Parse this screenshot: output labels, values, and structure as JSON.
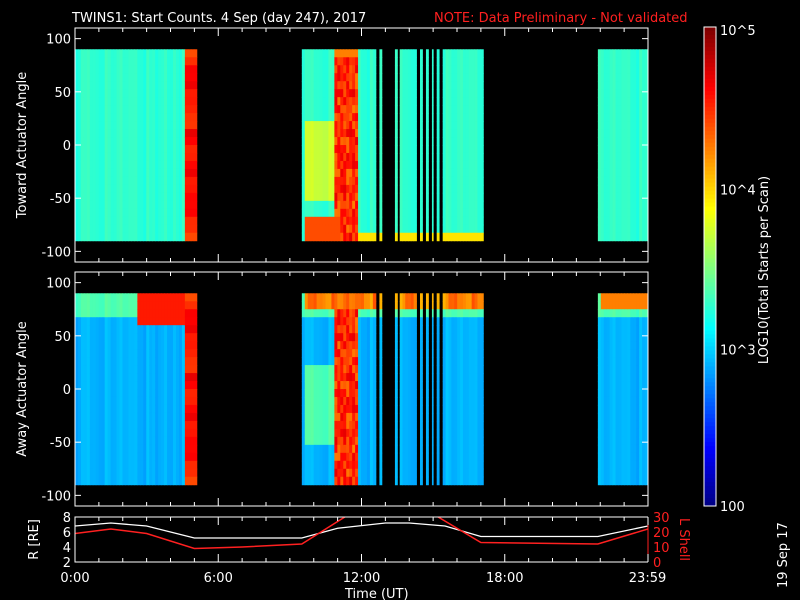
{
  "chart_data": {
    "type": "heatmap",
    "title": "TWINS1: Start Counts.  4 Sep (day 247), 2017",
    "note": "NOTE: Data Preliminary - Not validated",
    "date_stamp": "19 Sep 17",
    "xlabel": "Time (UT)",
    "xticks": [
      {
        "h": 0,
        "label": "0:00"
      },
      {
        "h": 6,
        "label": "6:00"
      },
      {
        "h": 12,
        "label": "12:00"
      },
      {
        "h": 18,
        "label": "18:00"
      },
      {
        "h": 23.98,
        "label": "23:59"
      }
    ],
    "xlim": [
      0,
      24
    ],
    "panels": [
      {
        "ylabel": "Toward Actuator Angle",
        "ylim": [
          -110,
          110
        ],
        "yticks": [
          "100",
          "50",
          "0",
          "-50",
          "-100"
        ],
        "ytick_values": [
          100,
          50,
          0,
          -50,
          -100
        ]
      },
      {
        "ylabel": "Away Actuator Angle",
        "ylim": [
          -110,
          110
        ],
        "yticks": [
          "100",
          "50",
          "0",
          "-50",
          "-100"
        ],
        "ytick_values": [
          100,
          50,
          0,
          -50,
          -100
        ]
      }
    ],
    "angle_range": [
      -90,
      90
    ],
    "data_intervals_hours": [
      [
        0,
        5.1
      ],
      [
        9.5,
        12.6
      ],
      [
        12.75,
        12.85
      ],
      [
        13.4,
        13.5
      ],
      [
        13.6,
        14.3
      ],
      [
        14.45,
        14.55
      ],
      [
        14.7,
        14.8
      ],
      [
        14.95,
        15.0
      ],
      [
        15.15,
        15.25
      ],
      [
        15.4,
        17.1
      ],
      [
        21.9,
        24
      ]
    ],
    "colorbar": {
      "label": "LOG10(Total Starts per Scan)",
      "min": 100,
      "max": 100000,
      "ticks": [
        {
          "v": 100,
          "label": "100"
        },
        {
          "v": 1000,
          "label": "10^3"
        },
        {
          "v": 10000,
          "label": "10^4"
        },
        {
          "v": 100000,
          "label": "10^5"
        }
      ]
    },
    "ephemeris": {
      "left_label": "R [RE]",
      "left_ylim": [
        2,
        8
      ],
      "left_ticks": [
        "2",
        "4",
        "6",
        "8"
      ],
      "right_label": "L Shell",
      "right_ylim": [
        0,
        30
      ],
      "right_ticks": [
        "0",
        "10",
        "20",
        "30"
      ],
      "R": {
        "x": [
          0,
          1.5,
          3,
          5,
          9.5,
          11,
          13,
          14,
          15.5,
          17,
          21.9,
          24
        ],
        "y": [
          6.8,
          7.2,
          6.8,
          5.2,
          5.2,
          6.5,
          7.2,
          7.2,
          6.8,
          5.4,
          5.4,
          6.8
        ]
      },
      "L": {
        "x": [
          0,
          1.5,
          3,
          5,
          7,
          9.5,
          11.5,
          15,
          17,
          21.9,
          24
        ],
        "y": [
          19,
          22,
          19,
          9,
          10,
          12,
          32,
          32,
          13,
          12,
          22
        ]
      }
    }
  }
}
